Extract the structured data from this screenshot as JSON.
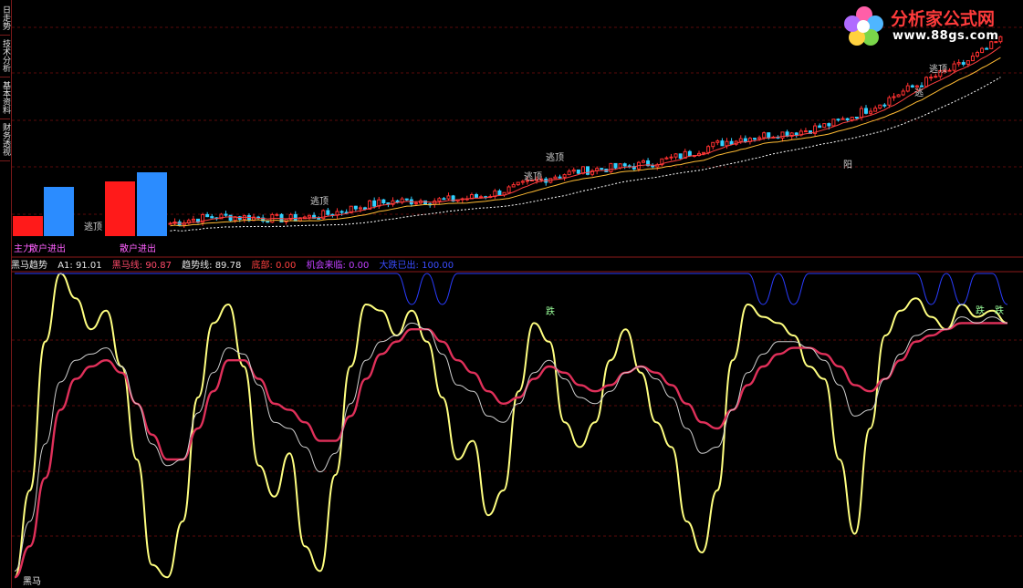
{
  "side_tabs": [
    "日走势",
    "技术分析",
    "基本资料",
    "财务透视"
  ],
  "logo": {
    "text": "分析家公式网",
    "url": "www.88gs.com"
  },
  "upper_panel": {
    "signal_labels": [
      "逃顶",
      "逃顶",
      "逃顶",
      "逃顶",
      "逃",
      "阳"
    ],
    "volume_labels": [
      "散户进出",
      "散户进出"
    ],
    "volume_label_prefix": "主力"
  },
  "lower_panel": {
    "legend": {
      "name": "黑马趋势",
      "a1": "A1: 91.01",
      "heima": "黑马线: 90.87",
      "trend": "趋势线: 89.78",
      "dibu": "底部: 0.00",
      "jihui": "机会来临: 0.00",
      "dadie": "大跌已出: 100.00"
    },
    "line_label": "黑马",
    "marker_labels": [
      "跌",
      "跌",
      "跌"
    ]
  },
  "colors": {
    "bg": "#000000",
    "grid": "#5a0a0a",
    "separator": "#8b1a1a",
    "yellow_line": "#ffff80",
    "red_line": "#e0305a",
    "white_line": "#d0d0d0",
    "blue_line": "#2a3cff",
    "candle_up": "#ff3030",
    "candle_down": "#30d0ff",
    "ma1": "#ff4040",
    "ma2": "#ffbb33",
    "ma3": "#ffffff"
  },
  "chart_data": [
    {
      "type": "candlestick",
      "title": "",
      "note": "price panel with candlesticks, moving averages and volume bars",
      "volume_bars": [
        {
          "label": "散户进出",
          "red": 22,
          "blue": 54
        },
        {
          "label": "散户进出",
          "red": 60,
          "blue": 70
        }
      ],
      "trend": [
        200,
        205,
        208,
        212,
        218,
        226,
        232,
        240,
        250,
        262,
        275,
        288,
        300,
        312,
        326,
        338,
        352,
        370,
        392,
        420,
        455,
        500
      ]
    },
    {
      "type": "line",
      "title": "黑马趋势",
      "ylim": [
        0,
        100
      ],
      "series": [
        {
          "name": "A1",
          "values": [
            2,
            30,
            78,
            100,
            92,
            82,
            88,
            70,
            40,
            6,
            2,
            20,
            60,
            84,
            90,
            70,
            38,
            28,
            42,
            12,
            4,
            35,
            70,
            90,
            88,
            80,
            88,
            78,
            60,
            40,
            46,
            22,
            30,
            62,
            84,
            78,
            52,
            44,
            52,
            72,
            82,
            68,
            52,
            44,
            20,
            10,
            30,
            72,
            90,
            86,
            84,
            80,
            70,
            66,
            40,
            16,
            50,
            80,
            88,
            92,
            86,
            82,
            90,
            86,
            88,
            84
          ]
        },
        {
          "name": "黑马线",
          "values": [
            2,
            12,
            34,
            56,
            66,
            70,
            72,
            68,
            58,
            48,
            40,
            40,
            50,
            62,
            72,
            72,
            66,
            58,
            56,
            52,
            46,
            46,
            54,
            66,
            74,
            78,
            82,
            82,
            78,
            72,
            68,
            62,
            58,
            60,
            66,
            70,
            68,
            64,
            62,
            64,
            68,
            70,
            68,
            64,
            58,
            52,
            50,
            56,
            64,
            70,
            74,
            76,
            76,
            74,
            70,
            64,
            62,
            66,
            72,
            78,
            80,
            82,
            84,
            84,
            84,
            84
          ]
        },
        {
          "name": "趋势线",
          "values": [
            4,
            20,
            45,
            65,
            72,
            74,
            76,
            70,
            58,
            45,
            38,
            40,
            55,
            68,
            76,
            74,
            64,
            52,
            50,
            44,
            36,
            42,
            58,
            72,
            78,
            80,
            84,
            82,
            74,
            64,
            62,
            54,
            52,
            58,
            68,
            72,
            66,
            60,
            58,
            62,
            68,
            70,
            66,
            60,
            50,
            42,
            44,
            56,
            68,
            74,
            78,
            78,
            76,
            72,
            64,
            54,
            56,
            66,
            74,
            80,
            82,
            82,
            86,
            84,
            86,
            84
          ]
        },
        {
          "name": "大跌已出",
          "values": [
            100,
            100,
            100,
            100,
            100,
            100,
            100,
            100,
            100,
            100,
            100,
            100,
            100,
            100,
            100,
            100,
            100,
            100,
            100,
            100,
            100,
            100,
            100,
            100,
            100,
            100,
            90,
            100,
            90,
            100,
            100,
            100,
            100,
            100,
            100,
            100,
            100,
            100,
            100,
            100,
            100,
            100,
            100,
            100,
            100,
            100,
            100,
            100,
            100,
            90,
            100,
            90,
            100,
            100,
            100,
            100,
            100,
            100,
            100,
            100,
            90,
            100,
            90,
            100,
            100,
            90
          ]
        }
      ]
    }
  ]
}
